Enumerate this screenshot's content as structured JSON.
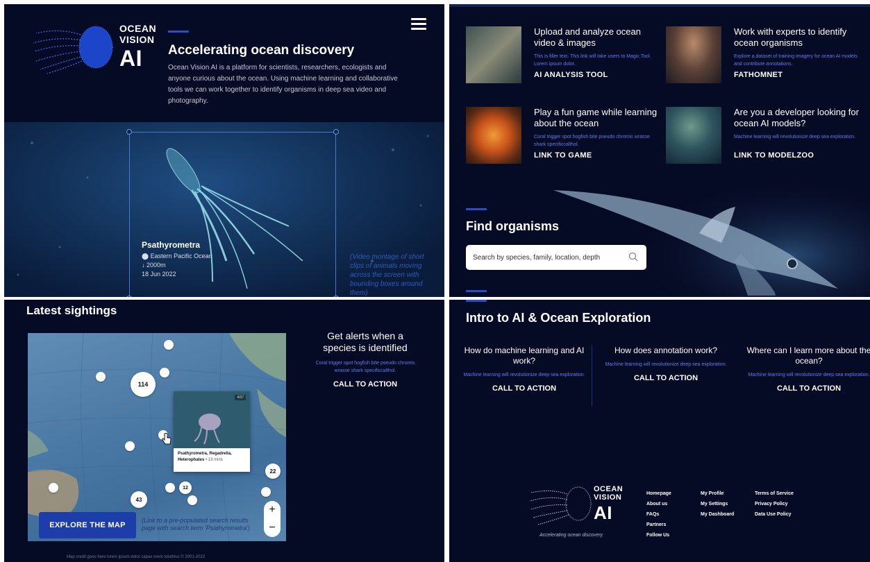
{
  "hero": {
    "logo": {
      "line1": "OCEAN",
      "line2": "VISION",
      "line3": "AI"
    },
    "title": "Accelerating ocean discovery",
    "body": "Ocean Vision AI is a platform for scientists, researchers, ecologists and anyone curious about the ocean. Using machine learning and collaborative tools we can work together to identify organisms in deep sea video and photography.",
    "species_name": "Psathyrometra",
    "location": "Eastern Pacific Ocean",
    "depth": "2000m",
    "date": "18 Jun 2022",
    "video_note": "(Video montage of short clips of animals moving across the screen with bounding boxes around them)"
  },
  "tools": [
    {
      "title": "Upload and analyze ocean video & images",
      "desc": "This is filler text. This link will take users to Magic Tool. Lorem ipsum dolor.",
      "link": "AI ANALYSIS TOOL"
    },
    {
      "title": "Work with experts to identify ocean organisms",
      "desc": "Explore a dataset of training imagery for ocean AI models and contribute annotations.",
      "link": "FATHOMNET"
    },
    {
      "title": "Play a fun game while learning about the ocean",
      "desc": "Coral trigger spot hogfish bite pseudo chromis wrasse shark specificcalthol.",
      "link": "LINK TO GAME"
    },
    {
      "title": "Are you a developer looking for ocean AI models?",
      "desc": "Machine learning will revolutionize deep sea exploration.",
      "link": "LINK TO MODELZOO"
    }
  ],
  "find": {
    "title": "Find organisms",
    "placeholder": "Search by species, family, location, depth"
  },
  "latest": {
    "title": "Latest sightings",
    "clusters": [
      "114",
      "22",
      "12",
      "43"
    ],
    "popup_badge": "4/37",
    "popup_names": "Psathyrometra, Regadrella, Heterophates",
    "popup_time": "• 13 mins",
    "zoom_in": "+",
    "zoom_out": "−",
    "explore_button": "EXPLORE THE MAP",
    "explore_note": "(Link to a pre-populated search results page with search term 'Psathyrometra')",
    "map_credit": "Map credit goes here lorem ipsum dolor capax orem toluthius © 2001-2022",
    "alerts_title": "Get alerts when a species is identified",
    "alerts_desc": "Coral trigger spot hogfish bite pseudo chromis wrasse shark specificcalthol.",
    "alerts_cta": "CALL TO ACTION"
  },
  "intro": {
    "title": "Intro to AI & Ocean Exploration",
    "columns": [
      {
        "title": "How do machine learning and AI work?",
        "desc": "Machine learning will revolutionize deep sea exploration.",
        "cta": "CALL TO ACTION"
      },
      {
        "title": "How does annotation work?",
        "desc": "Machine learning will revolutionize deep sea exploration.",
        "cta": "CALL TO ACTION"
      },
      {
        "title": "Where can I learn more about the ocean?",
        "desc": "Machine learning will revolutionize deep sea exploration.",
        "cta": "CALL TO ACTION"
      }
    ]
  },
  "footer": {
    "logo": {
      "line1": "OCEAN",
      "line2": "VISION",
      "line3": "AI"
    },
    "tagline": "Accelerating ocean discovery",
    "col1": [
      "Homepage",
      "About us",
      "FAQs",
      "Partners",
      "Follow Us"
    ],
    "col2": [
      "My Profile",
      "My Settings",
      "My Dashboard"
    ],
    "col3": [
      "Terms of Service",
      "Privacy Policy",
      "Data Use Policy"
    ]
  },
  "colors": {
    "background": "#060b25",
    "accent": "#2b4bc7",
    "link_blue": "#5b7df0",
    "button": "#1d3ea8"
  }
}
